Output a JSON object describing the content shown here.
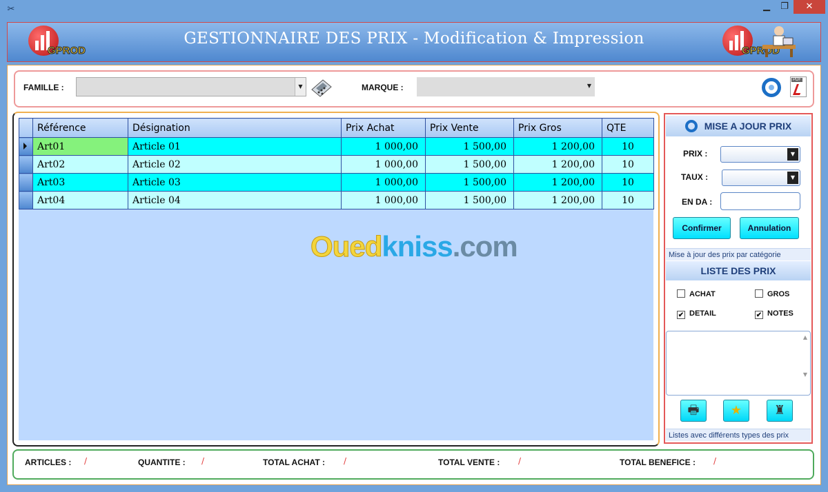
{
  "window": {
    "min": "▁",
    "max": "❐",
    "close": "✕"
  },
  "header": {
    "title": "GESTIONNAIRE DES PRIX - Modification & Impression",
    "logo_text": "GPROD"
  },
  "filters": {
    "famille_label": "FAMILLE :",
    "marque_label": "MARQUE :",
    "famille_value": "",
    "marque_value": ""
  },
  "grid": {
    "columns": [
      "Référence",
      "Désignation",
      "Prix Achat",
      "Prix Vente",
      "Prix Gros",
      "QTE"
    ],
    "rows": [
      [
        "Art01",
        "Article 01",
        "1 000,00",
        "1 500,00",
        "1 200,00",
        "10"
      ],
      [
        "Art02",
        "Article 02",
        "1 000,00",
        "1 500,00",
        "1 200,00",
        "10"
      ],
      [
        "Art03",
        "Article 03",
        "1 000,00",
        "1 500,00",
        "1 200,00",
        "10"
      ],
      [
        "Art04",
        "Article 04",
        "1 000,00",
        "1 500,00",
        "1 200,00",
        "10"
      ]
    ]
  },
  "watermark": {
    "part1": "Oued",
    "part2": "kniss",
    "part3": ".com"
  },
  "side": {
    "maj_title": "MISE A JOUR PRIX",
    "prix_label": "PRIX :",
    "taux_label": "TAUX :",
    "enda_label": "EN DA :",
    "confirm": "Confirmer",
    "cancel": "Annulation",
    "hint1": "Mise à jour des prix par catégorie",
    "liste_title": "LISTE DES PRIX",
    "achat": "ACHAT",
    "gros": "GROS",
    "detail": "DETAIL",
    "notes": "NOTES",
    "achat_checked": "",
    "gros_checked": "",
    "detail_checked": "✔",
    "notes_checked": "✔",
    "hint2": "Listes avec différents types des prix"
  },
  "footer": {
    "articles": "ARTICLES :",
    "articles_val": "/",
    "quantite": "QUANTITE :",
    "quantite_val": "/",
    "total_achat": "TOTAL ACHAT :",
    "total_achat_val": "/",
    "total_vente": "TOTAL VENTE :",
    "total_vente_val": "/",
    "total_benefice": "TOTAL BENEFICE :",
    "total_benefice_val": "/"
  },
  "icons": [
    "app-icon",
    "calculator-icon",
    "refresh-icon",
    "pdf-icon",
    "printer-icon",
    "star-icon",
    "user-icon"
  ]
}
